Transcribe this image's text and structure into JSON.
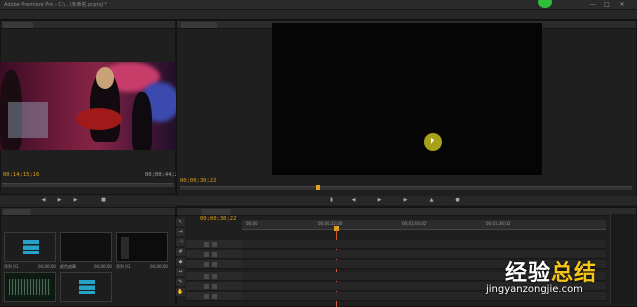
{
  "window": {
    "title": "Adobe Premiere Pro - C:\\...\\未命名.prproj *",
    "minimize": "—",
    "maximize": "□",
    "close": "✕"
  },
  "source_monitor": {
    "current_time": "00;14;15;16",
    "duration": "00;00;44;20"
  },
  "program_monitor": {
    "current_time": "00;00;30;22"
  },
  "timeline": {
    "current_time": "00;00;30;22",
    "ruler_labels": [
      "00;00",
      "00;00;32;00",
      "00;01;04;02",
      "00;01;36;02"
    ]
  },
  "project": {
    "items": [
      {
        "label": "序列 01",
        "meta": "00;00;00"
      },
      {
        "label": "颜色遮罩",
        "meta": "00;00;00"
      },
      {
        "label": "序列 01",
        "meta": "00;00;00"
      }
    ]
  },
  "watermark": {
    "brand_part1": "经验",
    "brand_part2": "总结",
    "url": "jingyanzongjie.com"
  },
  "colors": {
    "timecode": "#e0a020",
    "playhead": "#d05a2a",
    "cursor_halo": "#b8b21c",
    "watermark_accent": "#f5c518"
  }
}
